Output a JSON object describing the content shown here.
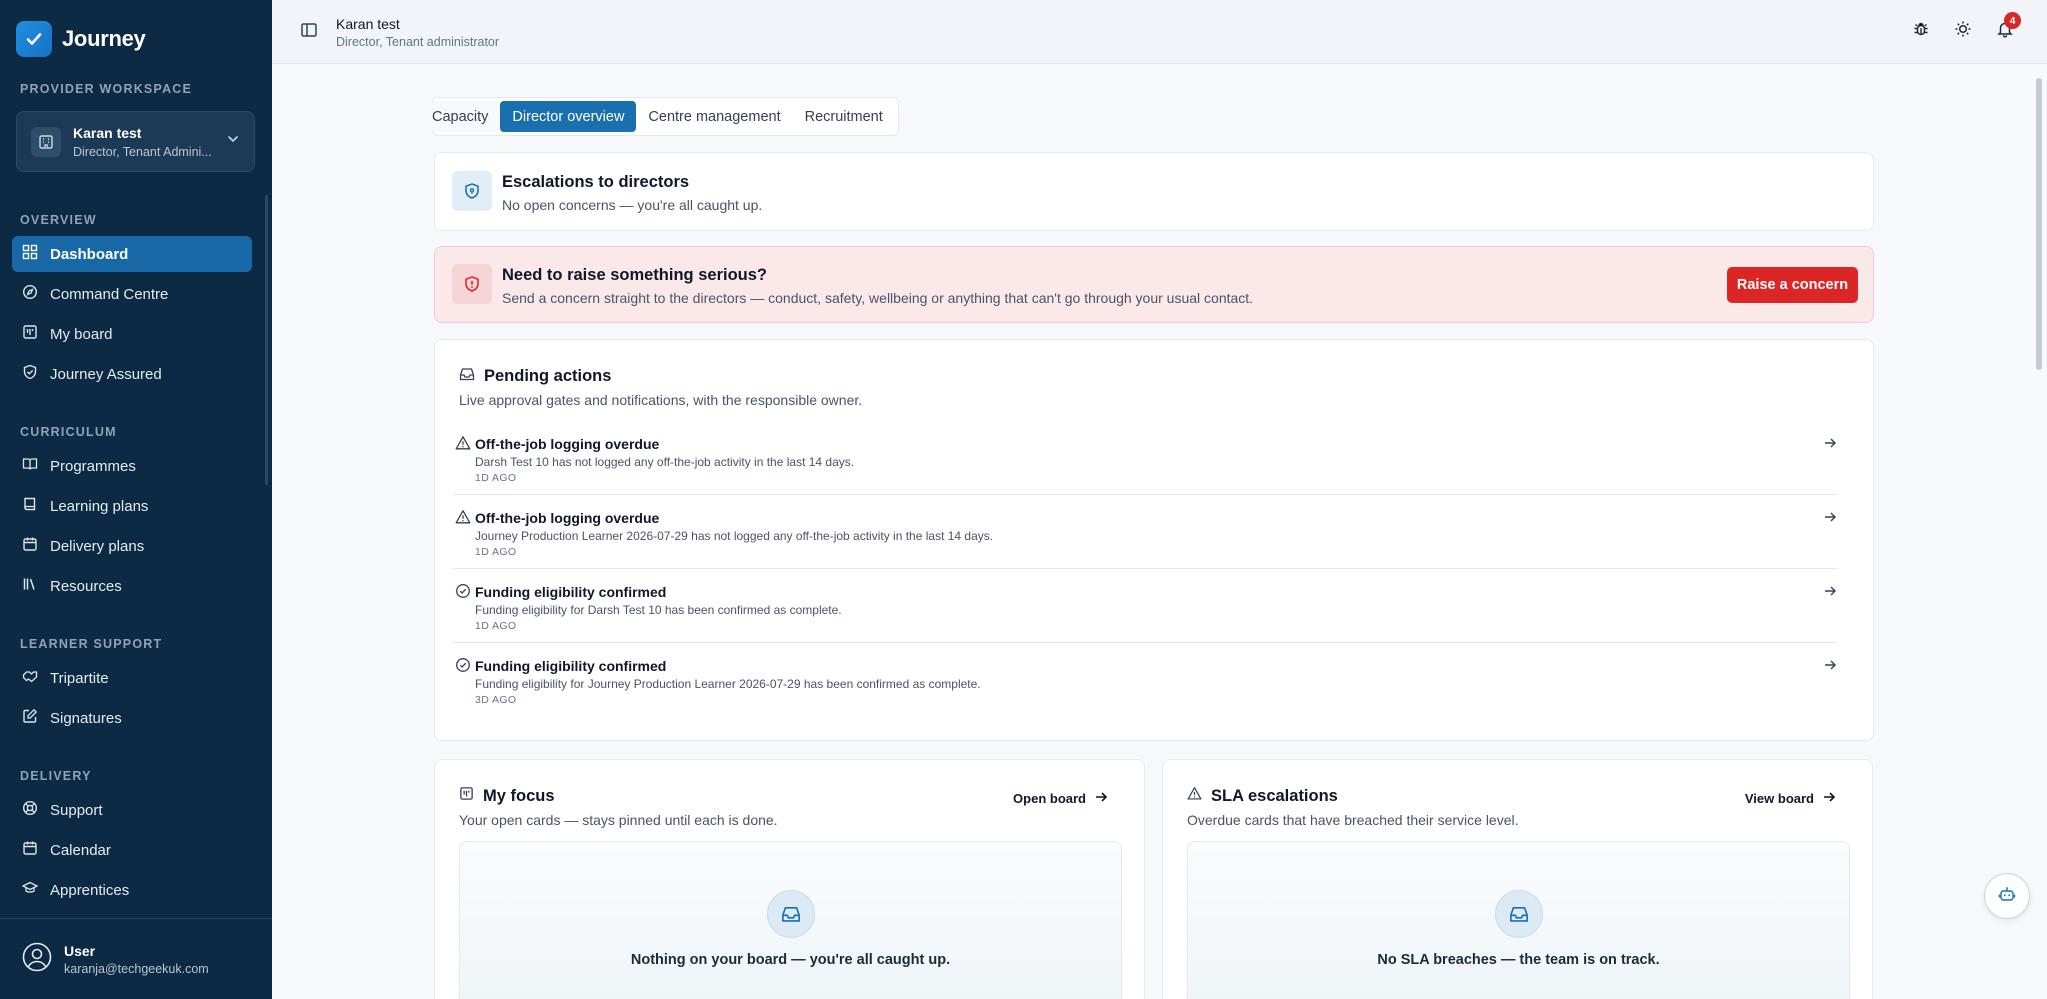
{
  "brand": {
    "name": "Journey"
  },
  "sidebar": {
    "workspace_label": "PROVIDER WORKSPACE",
    "workspace": {
      "name": "Karan test",
      "role": "Director, Tenant Admini..."
    },
    "sections": {
      "overview": "OVERVIEW",
      "curriculum": "CURRICULUM",
      "learner_support": "LEARNER SUPPORT",
      "delivery": "DELIVERY"
    },
    "items": {
      "dashboard": "Dashboard",
      "command_centre": "Command Centre",
      "my_board": "My board",
      "journey_assured": "Journey Assured",
      "programmes": "Programmes",
      "learning_plans": "Learning plans",
      "delivery_plans": "Delivery plans",
      "resources": "Resources",
      "tripartite": "Tripartite",
      "signatures": "Signatures",
      "support": "Support",
      "calendar": "Calendar",
      "apprentices": "Apprentices"
    },
    "user": {
      "name": "User",
      "email": "karanja@techgeekuk.com"
    }
  },
  "header": {
    "title": "Karan test",
    "subtitle": "Director, Tenant administrator",
    "notification_count": "4"
  },
  "tabs": [
    "Capacity",
    "Director overview",
    "Centre management",
    "Recruitment"
  ],
  "escalations": {
    "title": "Escalations to directors",
    "subtitle": "No open concerns — you're all caught up."
  },
  "raise": {
    "title": "Need to raise something serious?",
    "subtitle": "Send a concern straight to the directors — conduct, safety, wellbeing or anything that can't go through your usual contact.",
    "button": "Raise a concern"
  },
  "pending": {
    "title": "Pending actions",
    "subtitle": "Live approval gates and notifications, with the responsible owner.",
    "rows": [
      {
        "icon": "warning-icon",
        "title": "Off-the-job logging overdue",
        "desc": "Darsh Test 10 has not logged any off-the-job activity in the last 14 days.",
        "time": "1D AGO"
      },
      {
        "icon": "warning-icon",
        "title": "Off-the-job logging overdue",
        "desc": "Journey Production Learner 2026-07-29 has not logged any off-the-job activity in the last 14 days.",
        "time": "1D AGO"
      },
      {
        "icon": "check-circle-icon",
        "title": "Funding eligibility confirmed",
        "desc": "Funding eligibility for Darsh Test 10 has been confirmed as complete.",
        "time": "1D AGO"
      },
      {
        "icon": "check-circle-icon",
        "title": "Funding eligibility confirmed",
        "desc": "Funding eligibility for Journey Production Learner 2026-07-29 has been confirmed as complete.",
        "time": "3D AGO"
      }
    ]
  },
  "focus": {
    "title": "My focus",
    "subtitle": "Your open cards — stays pinned until each is done.",
    "link": "Open board",
    "empty": "Nothing on your board — you're all caught up."
  },
  "sla": {
    "title": "SLA escalations",
    "subtitle": "Overdue cards that have breached their service level.",
    "link": "View board",
    "empty": "No SLA breaches — the team is on track."
  },
  "colors": {
    "sidebar_bg": "#0d2a44",
    "accent": "#1a6fae",
    "danger": "#dc2626"
  }
}
